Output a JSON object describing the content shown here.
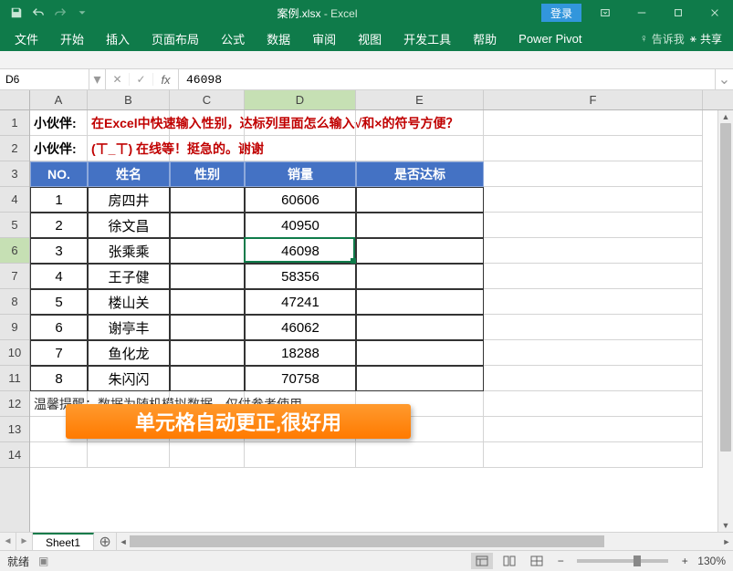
{
  "title": {
    "filename": "案例.xlsx",
    "app": "Excel"
  },
  "login_label": "登录",
  "ribbon_tabs": [
    "文件",
    "开始",
    "插入",
    "页面布局",
    "公式",
    "数据",
    "审阅",
    "视图",
    "开发工具",
    "帮助",
    "Power Pivot"
  ],
  "tell_me": "告诉我",
  "share": "共享",
  "name_box": "D6",
  "formula_value": "46098",
  "columns": [
    "A",
    "B",
    "C",
    "D",
    "E",
    "F"
  ],
  "row_numbers": [
    "1",
    "2",
    "3",
    "4",
    "5",
    "6",
    "7",
    "8",
    "9",
    "10",
    "11",
    "12",
    "13",
    "14"
  ],
  "row1": {
    "label": "小伙伴:",
    "text": "在Excel中快速输入性别，达标列里面怎么输入√和×的符号方便？"
  },
  "row2": {
    "label": "小伙伴:",
    "text": "(ㄒ_ㄒ) 在线等！挺急的。谢谢"
  },
  "table_headers": [
    "NO.",
    "姓名",
    "性别",
    "销量",
    "是否达标"
  ],
  "table_rows": [
    {
      "no": "1",
      "name": "房四井",
      "gender": "",
      "sales": "60606",
      "pass": ""
    },
    {
      "no": "2",
      "name": "徐文昌",
      "gender": "",
      "sales": "40950",
      "pass": ""
    },
    {
      "no": "3",
      "name": "张乘乘",
      "gender": "",
      "sales": "46098",
      "pass": ""
    },
    {
      "no": "4",
      "name": "王子健",
      "gender": "",
      "sales": "58356",
      "pass": ""
    },
    {
      "no": "5",
      "name": "楼山关",
      "gender": "",
      "sales": "47241",
      "pass": ""
    },
    {
      "no": "6",
      "name": "谢亭丰",
      "gender": "",
      "sales": "46062",
      "pass": ""
    },
    {
      "no": "7",
      "name": "鱼化龙",
      "gender": "",
      "sales": "18288",
      "pass": ""
    },
    {
      "no": "8",
      "name": "朱闪闪",
      "gender": "",
      "sales": "70758",
      "pass": ""
    }
  ],
  "footnote": "温馨提醒：数据为随机模拟数据，仅供参考使用。",
  "banner": "单元格自动更正,很好用",
  "sheet_name": "Sheet1",
  "status_ready": "就绪",
  "zoom": "130%",
  "active_cell": {
    "col": "D",
    "row": 6
  }
}
